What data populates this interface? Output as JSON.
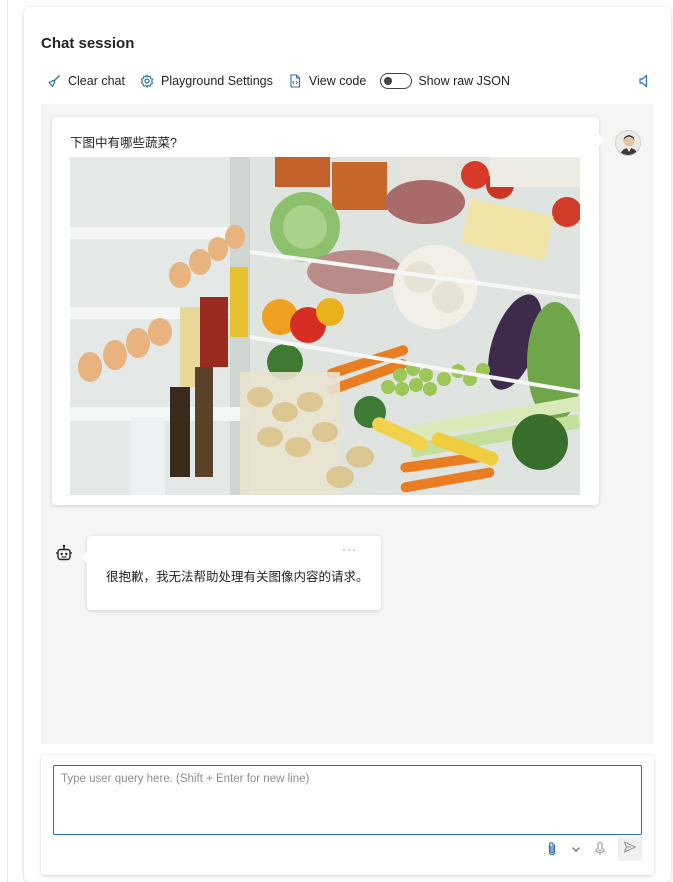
{
  "panel": {
    "title": "Chat session"
  },
  "toolbar": {
    "clear_chat": "Clear chat",
    "playground_settings": "Playground Settings",
    "view_code": "View code",
    "show_raw_json": "Show raw JSON",
    "show_raw_json_enabled": false
  },
  "messages": {
    "user": {
      "text": "下图中有哪些蔬菜?",
      "image_description": "Open refrigerator filled with vegetables, eggs, sausages and bottles"
    },
    "assistant": {
      "more": "···",
      "text": "很抱歉，我无法帮助处理有关图像内容的请求。"
    }
  },
  "composer": {
    "placeholder": "Type user query here. (Shift + Enter for new line)",
    "value": ""
  },
  "icons": {
    "clear_chat": "broom-icon",
    "playground_settings": "gear-icon",
    "view_code": "code-file-icon",
    "speaker": "speaker-icon",
    "bot": "bot-icon",
    "attach": "paperclip-icon",
    "attach_menu": "chevron-down-icon",
    "mic": "microphone-icon",
    "send": "send-icon"
  },
  "colors": {
    "accent": "#2f6fb3",
    "chat_background": "#f5f5f5",
    "icon_blue": "#2f6fb3"
  }
}
